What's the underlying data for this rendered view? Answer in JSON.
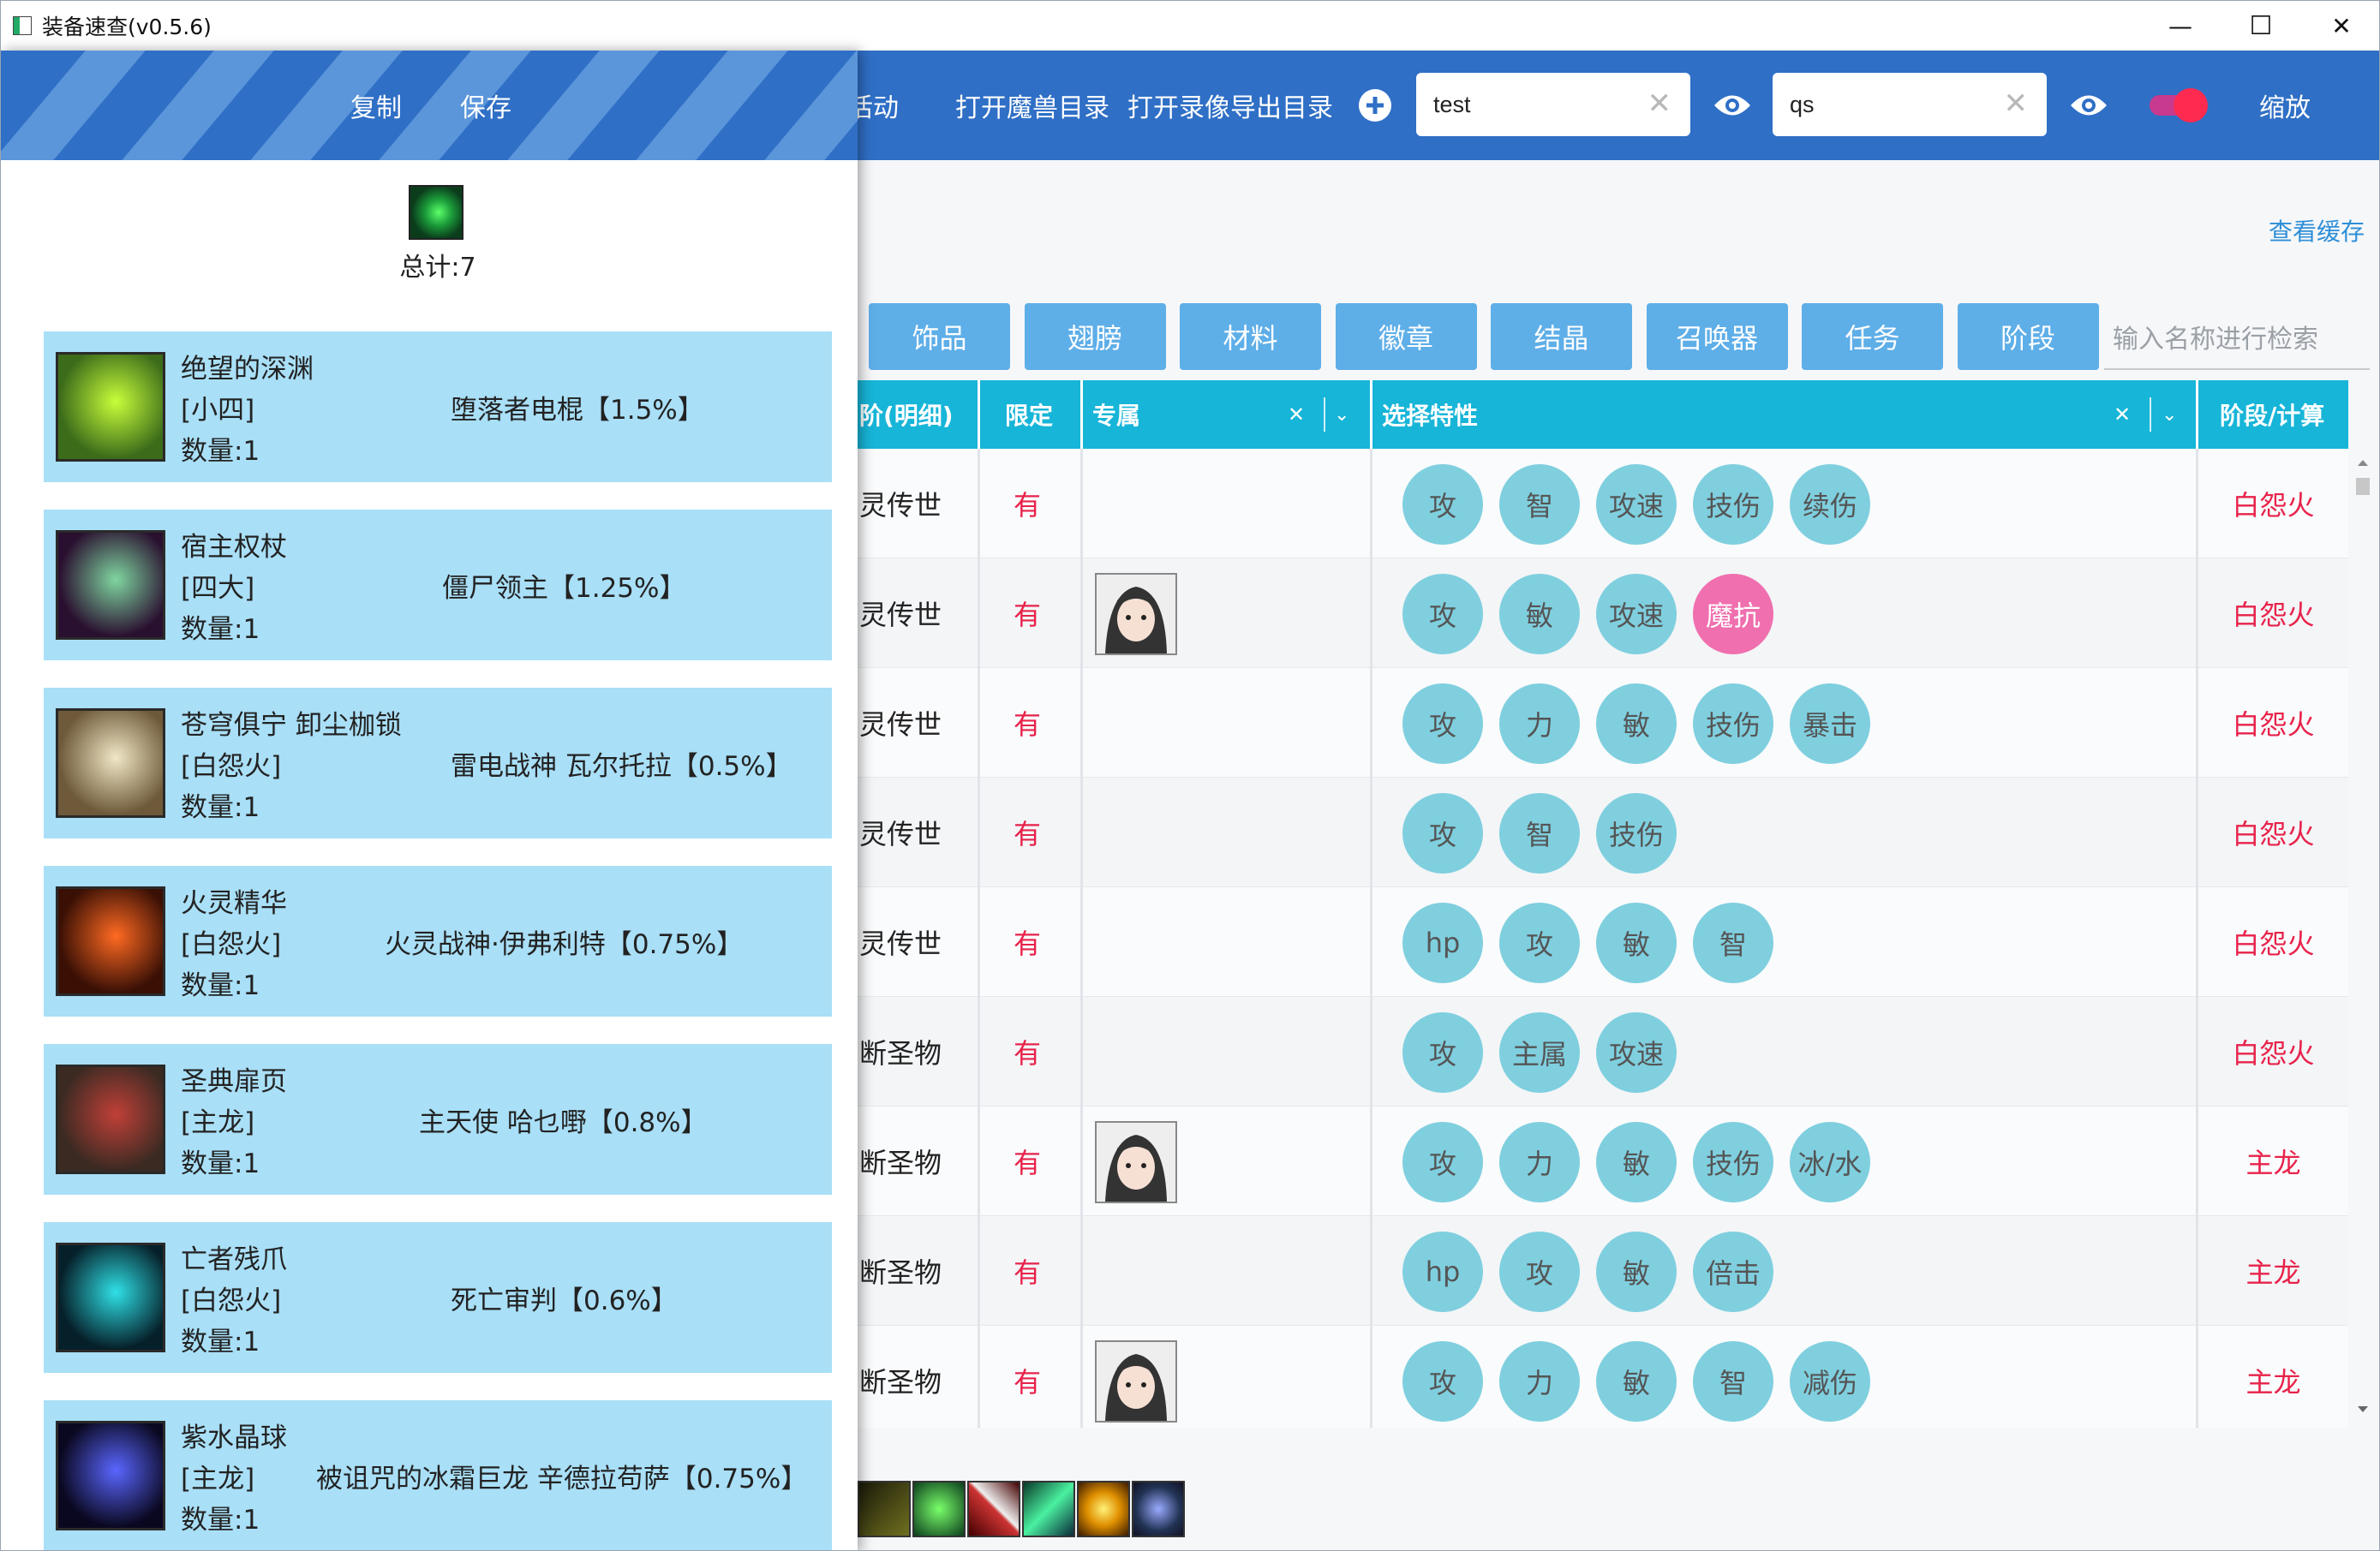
{
  "window": {
    "title": "装备速查(v0.5.6)",
    "controls": {
      "minimize": "—",
      "maximize": "☐",
      "close": "✕"
    }
  },
  "toolbar": {
    "copy": "复制",
    "save": "保存",
    "activity_partial": "活动",
    "open_warcraft_dir": "打开魔兽目录",
    "open_replay_export_dir": "打开录像导出目录",
    "search1": {
      "value": "test"
    },
    "search2": {
      "value": "qs"
    },
    "zoom": "缩放"
  },
  "cache_link": "查看缓存",
  "categories": [
    "饰品",
    "翅膀",
    "材料",
    "徽章",
    "结晶",
    "召唤器",
    "任务",
    "阶段"
  ],
  "name_search": {
    "placeholder": "输入名称进行检索"
  },
  "table": {
    "headers": {
      "stage_detail": "阶(明细)",
      "limited": "限定",
      "exclusive": "专属",
      "traits": "选择特性",
      "stage_calc": "阶段/计算"
    },
    "rows": [
      {
        "name": "灵传世",
        "limited": "有",
        "avatar": false,
        "traits": [
          "攻",
          "智",
          "攻速",
          "技伤",
          "续伤"
        ],
        "hot": [],
        "stage": "白怨火"
      },
      {
        "name": "灵传世",
        "limited": "有",
        "avatar": true,
        "traits": [
          "攻",
          "敏",
          "攻速",
          "魔抗"
        ],
        "hot": [
          3
        ],
        "stage": "白怨火"
      },
      {
        "name": "灵传世",
        "limited": "有",
        "avatar": false,
        "traits": [
          "攻",
          "力",
          "敏",
          "技伤",
          "暴击"
        ],
        "hot": [],
        "stage": "白怨火"
      },
      {
        "name": "灵传世",
        "limited": "有",
        "avatar": false,
        "traits": [
          "攻",
          "智",
          "技伤"
        ],
        "hot": [],
        "stage": "白怨火"
      },
      {
        "name": "灵传世",
        "limited": "有",
        "avatar": false,
        "traits": [
          "hp",
          "攻",
          "敏",
          "智"
        ],
        "hot": [],
        "stage": "白怨火"
      },
      {
        "name": "断圣物",
        "limited": "有",
        "avatar": false,
        "traits": [
          "攻",
          "主属",
          "攻速"
        ],
        "hot": [],
        "stage": "白怨火"
      },
      {
        "name": "断圣物",
        "limited": "有",
        "avatar": true,
        "traits": [
          "攻",
          "力",
          "敏",
          "技伤",
          "冰/水"
        ],
        "hot": [],
        "stage": "主龙"
      },
      {
        "name": "断圣物",
        "limited": "有",
        "avatar": false,
        "traits": [
          "hp",
          "攻",
          "敏",
          "倍击"
        ],
        "hot": [],
        "stage": "主龙"
      },
      {
        "name": "断圣物",
        "limited": "有",
        "avatar": true,
        "traits": [
          "攻",
          "力",
          "敏",
          "智",
          "减伤"
        ],
        "hot": [],
        "stage": "主龙"
      }
    ]
  },
  "panel": {
    "total": "总计:7",
    "items": [
      {
        "name": "绝望的深渊",
        "tier": "[小四]",
        "source": "堕落者电棍【1.5%】",
        "qty": "数量:1",
        "colors": [
          "#3c6b1a",
          "#c8ff3a"
        ]
      },
      {
        "name": "宿主权杖",
        "tier": "[四大]",
        "source": "僵尸领主【1.25%】",
        "qty": "数量:1",
        "colors": [
          "#2a1030",
          "#7fd6a0"
        ]
      },
      {
        "name": "苍穹俱宁 卸尘枷锁",
        "tier": "[白怨火]",
        "source": "雷电战神 瓦尔托拉【0.5%】",
        "qty": "数量:1",
        "colors": [
          "#6e5a3a",
          "#f0e7c6"
        ]
      },
      {
        "name": "火灵精华",
        "tier": "[白怨火]",
        "source": "火灵战神·伊弗利特【0.75%】",
        "qty": "数量:1",
        "colors": [
          "#3a1005",
          "#ff6a22"
        ]
      },
      {
        "name": "圣典扉页",
        "tier": "[主龙]",
        "source": "主天使 哈乜嘢【0.8%】",
        "qty": "数量:1",
        "colors": [
          "#3a2a22",
          "#c04038"
        ]
      },
      {
        "name": "亡者残爪",
        "tier": "[白怨火]",
        "source": "死亡审判【0.6%】",
        "qty": "数量:1",
        "colors": [
          "#06202a",
          "#2fe0e6"
        ]
      },
      {
        "name": "紫水晶球",
        "tier": "[主龙]",
        "source": "被诅咒的冰霜巨龙 辛德拉苟萨【0.75%】",
        "qty": "数量:1",
        "colors": [
          "#0a0820",
          "#5a66ff"
        ]
      }
    ]
  }
}
